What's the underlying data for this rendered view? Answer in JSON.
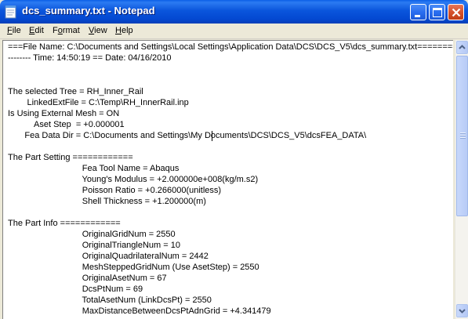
{
  "window": {
    "title": "dcs_summary.txt - Notepad",
    "accent_color": "#0a55dc",
    "close_color": "#c13e17"
  },
  "menu": [
    {
      "accel": "F",
      "rest": "ile"
    },
    {
      "accel": "E",
      "rest": "dit"
    },
    {
      "pre": "F",
      "accel": "o",
      "rest": "rmat"
    },
    {
      "accel": "V",
      "rest": "iew"
    },
    {
      "accel": "H",
      "rest": "elp"
    }
  ],
  "document": {
    "lines": [
      "===File Name: C:\\Documents and Settings\\Local Settings\\Application Data\\DCS\\DCS_V5\\dcs_summary.txt========",
      "-------- Time: 14:50:19 == Date: 04/16/2010",
      "",
      "",
      "The selected Tree = RH_Inner_Rail",
      "        LinkedExtFile = C:\\Temp\\RH_InnerRail.inp",
      "Is Using External Mesh = ON",
      "           Aset Step  = +0.000001",
      "       Fea Data Dir = C:\\Documents and Settings\\My Documents\\DCS\\DCS_V5\\dcsFEA_DATA\\",
      "",
      "The Part Setting ============",
      "                               Fea Tool Name = Abaqus",
      "                               Young's Modulus = +2.000000e+008(kg/m.s2)",
      "                               Poisson Ratio = +0.266000(unitless)",
      "                               Shell Thickness = +1.200000(m)",
      "",
      "The Part Info ============",
      "                               OriginalGridNum = 2550",
      "                               OriginalTriangleNum = 10",
      "                               OriginalQuadrilateralNum = 2442",
      "                               MeshSteppedGridNum (Use AsetStep) = 2550",
      "                               OriginalAsetNum = 67",
      "                               DcsPtNum = 69",
      "                               TotalAsetNum (LinkDcsPt) = 2550",
      "                               MaxDistanceBetweenDcsPtAdnGrid = +4.341479"
    ]
  }
}
